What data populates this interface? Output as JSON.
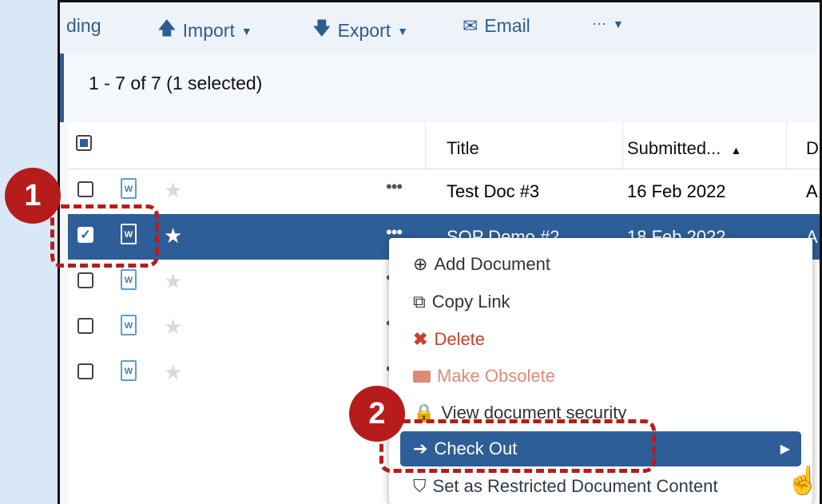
{
  "toolbar": {
    "partial_label": "ding",
    "import_label": "Import",
    "export_label": "Export",
    "email_label": "Email",
    "more_label": "···"
  },
  "summary": {
    "count_text": "1 - 7 of 7 (1 selected)"
  },
  "table": {
    "headers": {
      "title": "Title",
      "submitted": "Submitted...",
      "next": "D"
    },
    "rows": [
      {
        "title": "Test Doc #3",
        "submitted": "16 Feb 2022",
        "next": "A",
        "checked": false,
        "selected": false
      },
      {
        "title": "SOP Demo #2",
        "submitted": "18 Feb 2022",
        "next": "A",
        "checked": true,
        "selected": true
      },
      {
        "title": "",
        "submitted": "",
        "next": "",
        "checked": false,
        "selected": false
      },
      {
        "title": "",
        "submitted": "",
        "next": "",
        "checked": false,
        "selected": false
      },
      {
        "title": "",
        "submitted": "",
        "next": "",
        "checked": false,
        "selected": false
      }
    ]
  },
  "context_menu": {
    "items": [
      {
        "label": "Add Document",
        "icon": "plus-circle-icon"
      },
      {
        "label": "Copy Link",
        "icon": "copy-icon"
      },
      {
        "label": "Delete",
        "icon": "x-icon"
      },
      {
        "label": "Make Obsolete",
        "icon": "folder-icon"
      },
      {
        "label": "View document security",
        "icon": "lock-icon"
      },
      {
        "label": "Check Out",
        "icon": "sign-out-icon"
      },
      {
        "label": "Set as Restricted Document Content",
        "icon": "shield-icon"
      }
    ]
  },
  "annotations": {
    "step1": "1",
    "step2": "2"
  },
  "colors": {
    "accent": "#2e5e97",
    "annotation": "#b71c1c",
    "link": "#2d5c8f"
  }
}
